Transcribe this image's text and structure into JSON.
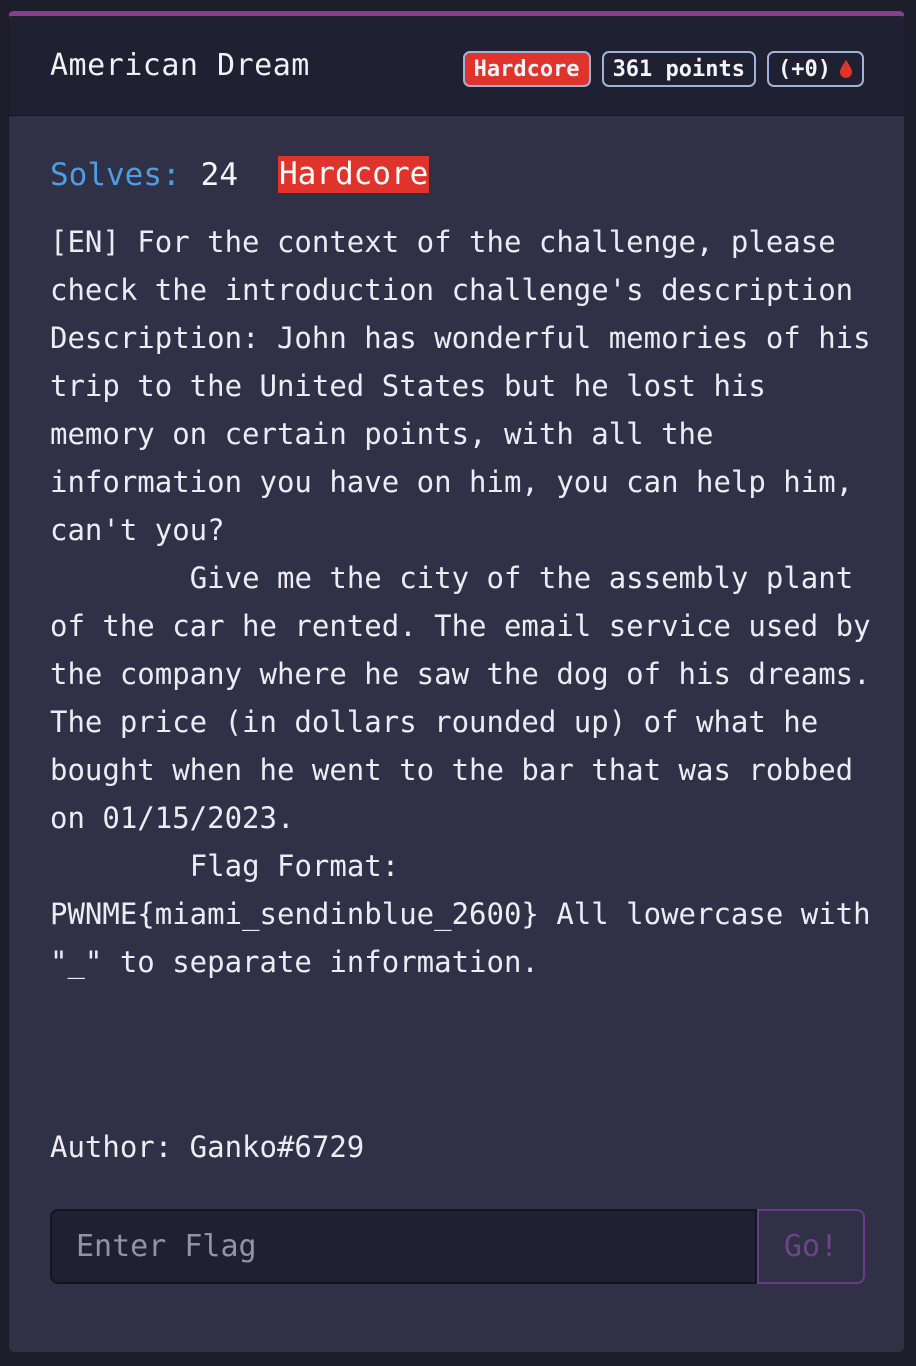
{
  "challenge": {
    "title": "American Dream",
    "badges": {
      "difficulty": "Hardcore",
      "points": "361 points",
      "bonus": "(+0)",
      "bonus_icon": "blood-drop-icon"
    },
    "solves_label": "Solves:",
    "solves_count": "24",
    "difficulty_tag": "Hardcore",
    "description": "[EN] For the context of the challenge, please check the introduction challenge's description\nDescription: John has wonderful memories of his trip to the United States but he lost his memory on certain points, with all the information you have on him, you can help him, can't you?\n        Give me the city of the assembly plant of the car he rented. The email service used by the company where he saw the dog of his dreams. The price (in dollars rounded up) of what he bought when he went to the bar that was robbed on 01/15/2023.\n        Flag Format:\nPWNME{miami_sendinblue_2600} All lowercase with \"_\" to separate information.\n",
    "author": "Author: Ganko#6729"
  },
  "form": {
    "flag_placeholder": "Enter Flag",
    "submit_label": "Go!"
  },
  "colors": {
    "accent_top": "#8a3d8e",
    "hardcore_red": "#e0332b",
    "solves_blue": "#4d9de0",
    "card_bg": "#303147",
    "header_bg": "#1f2031"
  }
}
